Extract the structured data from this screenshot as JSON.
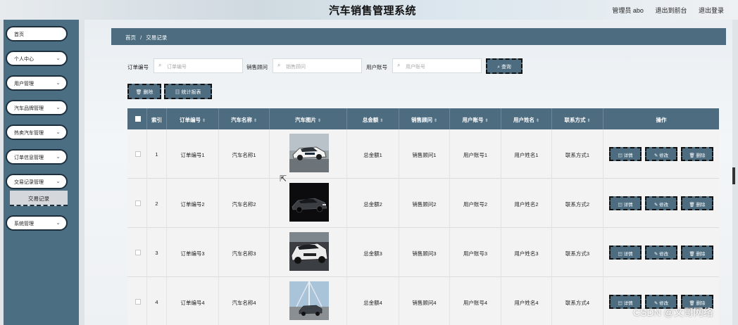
{
  "header": {
    "title": "汽车销售管理系统",
    "admin_label": "管理员 abo",
    "frontend_link": "退出到前台",
    "logout_link": "退出登录"
  },
  "sidebar": {
    "items": [
      {
        "label": "首页"
      },
      {
        "label": "个人中心"
      },
      {
        "label": "用户管理"
      },
      {
        "label": "汽车品牌管理"
      },
      {
        "label": "热卖汽车管理"
      },
      {
        "label": "订单信息管理"
      },
      {
        "label": "交易记录管理"
      },
      {
        "label": "系统管理"
      }
    ],
    "active_sub": "交易记录"
  },
  "breadcrumb": {
    "home": "首页",
    "sep": "/",
    "current": "交易记录"
  },
  "search": {
    "order_label": "订单编号",
    "order_placeholder": "订单编号",
    "advisor_label": "销售顾问",
    "advisor_placeholder": "销售顾问",
    "account_label": "用户账号",
    "account_placeholder": "用户账号",
    "search_button": "查询"
  },
  "toolbar": {
    "delete_label": "删除",
    "report_label": "统计报表"
  },
  "table": {
    "headers": {
      "index": "索引",
      "order_no": "订单编号",
      "car_name": "汽车名称",
      "car_image": "汽车图片",
      "total": "总金额",
      "advisor": "销售顾问",
      "account": "用户账号",
      "user_name": "用户姓名",
      "contact": "联系方式",
      "actions": "操作"
    },
    "rows": [
      {
        "index": "1",
        "order_no": "订单编号1",
        "car_name": "汽车名称1",
        "total": "总金额1",
        "advisor": "销售顾问1",
        "account": "用户账号1",
        "user_name": "用户姓名1",
        "contact": "联系方式1"
      },
      {
        "index": "2",
        "order_no": "订单编号2",
        "car_name": "汽车名称2",
        "total": "总金额2",
        "advisor": "销售顾问2",
        "account": "用户账号2",
        "user_name": "用户姓名2",
        "contact": "联系方式2"
      },
      {
        "index": "3",
        "order_no": "订单编号3",
        "car_name": "汽车名称3",
        "total": "总金额3",
        "advisor": "销售顾问3",
        "account": "用户账号3",
        "user_name": "用户姓名3",
        "contact": "联系方式3"
      },
      {
        "index": "4",
        "order_no": "订单编号4",
        "car_name": "汽车名称4",
        "total": "总金额4",
        "advisor": "销售顾问4",
        "account": "用户账号4",
        "user_name": "用户姓名4",
        "contact": "联系方式4"
      }
    ],
    "action_labels": {
      "detail": "详情",
      "edit": "修改",
      "delete": "删除"
    }
  },
  "watermark": "CSDN @文哥网络",
  "colors": {
    "primary": "#4d6c80",
    "sidebar": "#4c6e83",
    "border_dash": "#111111"
  },
  "icons": [
    "search-icon",
    "delete-icon",
    "chart-icon",
    "detail-icon",
    "edit-icon",
    "sort-icon",
    "chevron-down-icon"
  ]
}
